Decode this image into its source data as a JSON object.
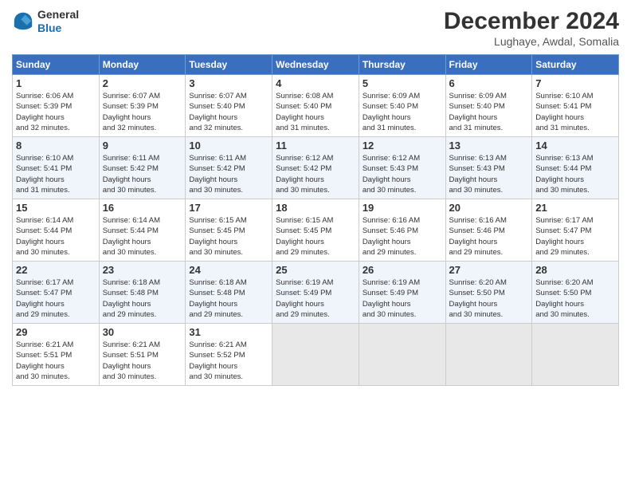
{
  "header": {
    "logo_line1": "General",
    "logo_line2": "Blue",
    "title": "December 2024",
    "location": "Lughaye, Awdal, Somalia"
  },
  "weekdays": [
    "Sunday",
    "Monday",
    "Tuesday",
    "Wednesday",
    "Thursday",
    "Friday",
    "Saturday"
  ],
  "weeks": [
    [
      {
        "day": "1",
        "sunrise": "6:06 AM",
        "sunset": "5:39 PM",
        "daylight": "11 hours and 32 minutes."
      },
      {
        "day": "2",
        "sunrise": "6:07 AM",
        "sunset": "5:39 PM",
        "daylight": "11 hours and 32 minutes."
      },
      {
        "day": "3",
        "sunrise": "6:07 AM",
        "sunset": "5:40 PM",
        "daylight": "11 hours and 32 minutes."
      },
      {
        "day": "4",
        "sunrise": "6:08 AM",
        "sunset": "5:40 PM",
        "daylight": "11 hours and 31 minutes."
      },
      {
        "day": "5",
        "sunrise": "6:09 AM",
        "sunset": "5:40 PM",
        "daylight": "11 hours and 31 minutes."
      },
      {
        "day": "6",
        "sunrise": "6:09 AM",
        "sunset": "5:40 PM",
        "daylight": "11 hours and 31 minutes."
      },
      {
        "day": "7",
        "sunrise": "6:10 AM",
        "sunset": "5:41 PM",
        "daylight": "11 hours and 31 minutes."
      }
    ],
    [
      {
        "day": "8",
        "sunrise": "6:10 AM",
        "sunset": "5:41 PM",
        "daylight": "11 hours and 31 minutes."
      },
      {
        "day": "9",
        "sunrise": "6:11 AM",
        "sunset": "5:42 PM",
        "daylight": "11 hours and 30 minutes."
      },
      {
        "day": "10",
        "sunrise": "6:11 AM",
        "sunset": "5:42 PM",
        "daylight": "11 hours and 30 minutes."
      },
      {
        "day": "11",
        "sunrise": "6:12 AM",
        "sunset": "5:42 PM",
        "daylight": "11 hours and 30 minutes."
      },
      {
        "day": "12",
        "sunrise": "6:12 AM",
        "sunset": "5:43 PM",
        "daylight": "11 hours and 30 minutes."
      },
      {
        "day": "13",
        "sunrise": "6:13 AM",
        "sunset": "5:43 PM",
        "daylight": "11 hours and 30 minutes."
      },
      {
        "day": "14",
        "sunrise": "6:13 AM",
        "sunset": "5:44 PM",
        "daylight": "11 hours and 30 minutes."
      }
    ],
    [
      {
        "day": "15",
        "sunrise": "6:14 AM",
        "sunset": "5:44 PM",
        "daylight": "11 hours and 30 minutes."
      },
      {
        "day": "16",
        "sunrise": "6:14 AM",
        "sunset": "5:44 PM",
        "daylight": "11 hours and 30 minutes."
      },
      {
        "day": "17",
        "sunrise": "6:15 AM",
        "sunset": "5:45 PM",
        "daylight": "11 hours and 30 minutes."
      },
      {
        "day": "18",
        "sunrise": "6:15 AM",
        "sunset": "5:45 PM",
        "daylight": "11 hours and 29 minutes."
      },
      {
        "day": "19",
        "sunrise": "6:16 AM",
        "sunset": "5:46 PM",
        "daylight": "11 hours and 29 minutes."
      },
      {
        "day": "20",
        "sunrise": "6:16 AM",
        "sunset": "5:46 PM",
        "daylight": "11 hours and 29 minutes."
      },
      {
        "day": "21",
        "sunrise": "6:17 AM",
        "sunset": "5:47 PM",
        "daylight": "11 hours and 29 minutes."
      }
    ],
    [
      {
        "day": "22",
        "sunrise": "6:17 AM",
        "sunset": "5:47 PM",
        "daylight": "11 hours and 29 minutes."
      },
      {
        "day": "23",
        "sunrise": "6:18 AM",
        "sunset": "5:48 PM",
        "daylight": "11 hours and 29 minutes."
      },
      {
        "day": "24",
        "sunrise": "6:18 AM",
        "sunset": "5:48 PM",
        "daylight": "11 hours and 29 minutes."
      },
      {
        "day": "25",
        "sunrise": "6:19 AM",
        "sunset": "5:49 PM",
        "daylight": "11 hours and 29 minutes."
      },
      {
        "day": "26",
        "sunrise": "6:19 AM",
        "sunset": "5:49 PM",
        "daylight": "11 hours and 30 minutes."
      },
      {
        "day": "27",
        "sunrise": "6:20 AM",
        "sunset": "5:50 PM",
        "daylight": "11 hours and 30 minutes."
      },
      {
        "day": "28",
        "sunrise": "6:20 AM",
        "sunset": "5:50 PM",
        "daylight": "11 hours and 30 minutes."
      }
    ],
    [
      {
        "day": "29",
        "sunrise": "6:21 AM",
        "sunset": "5:51 PM",
        "daylight": "11 hours and 30 minutes."
      },
      {
        "day": "30",
        "sunrise": "6:21 AM",
        "sunset": "5:51 PM",
        "daylight": "11 hours and 30 minutes."
      },
      {
        "day": "31",
        "sunrise": "6:21 AM",
        "sunset": "5:52 PM",
        "daylight": "11 hours and 30 minutes."
      },
      null,
      null,
      null,
      null
    ]
  ]
}
